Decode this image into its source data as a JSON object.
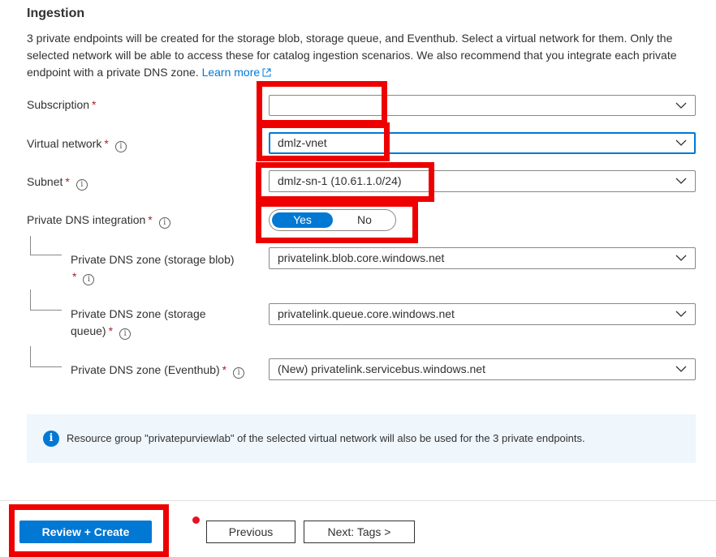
{
  "section": {
    "title": "Ingestion",
    "description": "3 private endpoints will be created for the storage blob, storage queue, and Eventhub. Select a virtual network for them. Only the selected network will be able to access these for catalog ingestion scenarios. We also recommend that you integrate each private endpoint with a private DNS zone.",
    "learn_more": "Learn more"
  },
  "fields": {
    "subscription": {
      "label": "Subscription",
      "required": "*",
      "value": ""
    },
    "virtual_network": {
      "label": "Virtual network",
      "required": "*",
      "value": "dmlz-vnet"
    },
    "subnet": {
      "label": "Subnet",
      "required": "*",
      "value": "dmlz-sn-1 (10.61.1.0/24)"
    },
    "private_dns": {
      "label": "Private DNS integration",
      "required": "*",
      "yes": "Yes",
      "no": "No",
      "selected": "Yes"
    }
  },
  "dns_zones": {
    "blob": {
      "label_line1": "Private DNS zone (storage blob)",
      "required": "*",
      "value": "privatelink.blob.core.windows.net"
    },
    "queue": {
      "label_line1": "Private DNS zone (storage",
      "label_line2": "queue)",
      "required": "*",
      "value": "privatelink.queue.core.windows.net"
    },
    "eventhub": {
      "label_line1": "Private DNS zone (Eventhub)",
      "required": "*",
      "value": "(New) privatelink.servicebus.windows.net"
    }
  },
  "info_bar": {
    "message": "Resource group \"privatepurviewlab\" of the selected virtual network will also be used for the 3 private endpoints."
  },
  "footer": {
    "review_create": "Review + Create",
    "previous": "Previous",
    "next": "Next: Tags >"
  },
  "icons": {
    "info": "info-icon",
    "chevron": "chevron-down-icon",
    "external_link": "external-link-icon"
  },
  "colors": {
    "accent": "#0078d4",
    "required": "#a4262c",
    "highlight": "#ee0000",
    "info_bar_bg": "#eff6fc"
  }
}
